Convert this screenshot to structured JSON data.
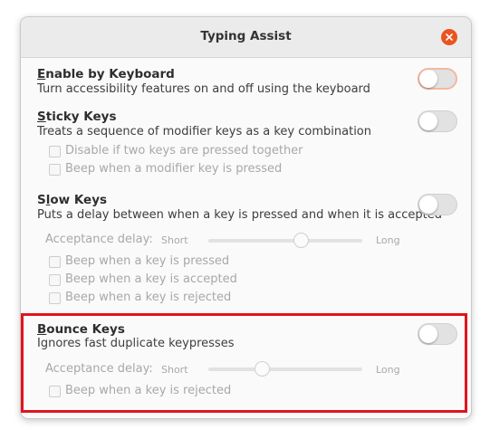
{
  "window": {
    "title": "Typing Assist",
    "close_icon": "close-icon"
  },
  "sections": {
    "enable_by_keyboard": {
      "mnemonic": "E",
      "title_rest": "nable by Keyboard",
      "description": "Turn accessibility features on and off using the keyboard",
      "enabled": false
    },
    "sticky_keys": {
      "mnemonic": "S",
      "title_rest": "ticky Keys",
      "description": "Treats a sequence of modifier keys as a key combination",
      "enabled": false,
      "options": {
        "disable_two_keys": "Disable if two keys are pressed together",
        "beep_modifier": "Beep when a modifier key is pressed"
      }
    },
    "slow_keys": {
      "mnemonic_pre": "S",
      "mnemonic": "l",
      "title_rest": "ow Keys",
      "description": "Puts a delay between when a key is pressed and when it is accepted",
      "enabled": false,
      "delay_label": "Acceptance delay:",
      "short_label": "Short",
      "long_label": "Long",
      "delay_level": 0.6,
      "options": {
        "beep_pressed": "Beep when a key is pressed",
        "beep_accepted": "Beep when a key is accepted",
        "beep_rejected": "Beep when a key is rejected"
      }
    },
    "bounce_keys": {
      "mnemonic": "B",
      "title_rest": "ounce Keys",
      "description": "Ignores fast duplicate keypresses",
      "enabled": false,
      "delay_label": "Acceptance delay:",
      "short_label": "Short",
      "long_label": "Long",
      "delay_level": 0.35,
      "options": {
        "beep_rejected": "Beep when a key is rejected"
      }
    }
  },
  "colors": {
    "close_button": "#e95420",
    "highlight_border": "#e0141e",
    "focus_ring": "#f3b8a1"
  }
}
